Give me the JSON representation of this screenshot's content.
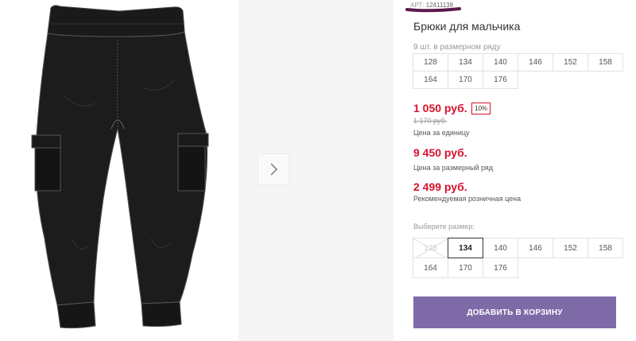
{
  "product": {
    "article_label": "АРТ:",
    "article_value": "12411138",
    "title": "Брюки для мальчика"
  },
  "size_row": {
    "label": "9 шт. в размерном ряду",
    "sizes": [
      "128",
      "134",
      "140",
      "146",
      "152",
      "158",
      "164",
      "170",
      "176"
    ]
  },
  "pricing": {
    "unit_price": "1 050 руб.",
    "discount": "10%",
    "old_price": "1 170 руб.",
    "unit_price_label": "Цена за единицу",
    "row_price": "9 450 руб.",
    "row_price_label": "Цена за размерный ряд",
    "retail_price": "2 499 руб.",
    "retail_price_label": "Рекомендуемая розничная цена"
  },
  "size_select": {
    "label": "Выберите размер:",
    "sizes": [
      "128",
      "134",
      "140",
      "146",
      "152",
      "158",
      "164",
      "170",
      "176"
    ],
    "selected": "134",
    "unavailable": [
      "128"
    ]
  },
  "cart": {
    "add_label": "ДОБАВИТЬ В КОРЗИНУ"
  },
  "colors": {
    "accent": "#7f6aa8",
    "price": "#d6122d"
  },
  "icons": {
    "gallery_next": "chevron-right-icon"
  }
}
